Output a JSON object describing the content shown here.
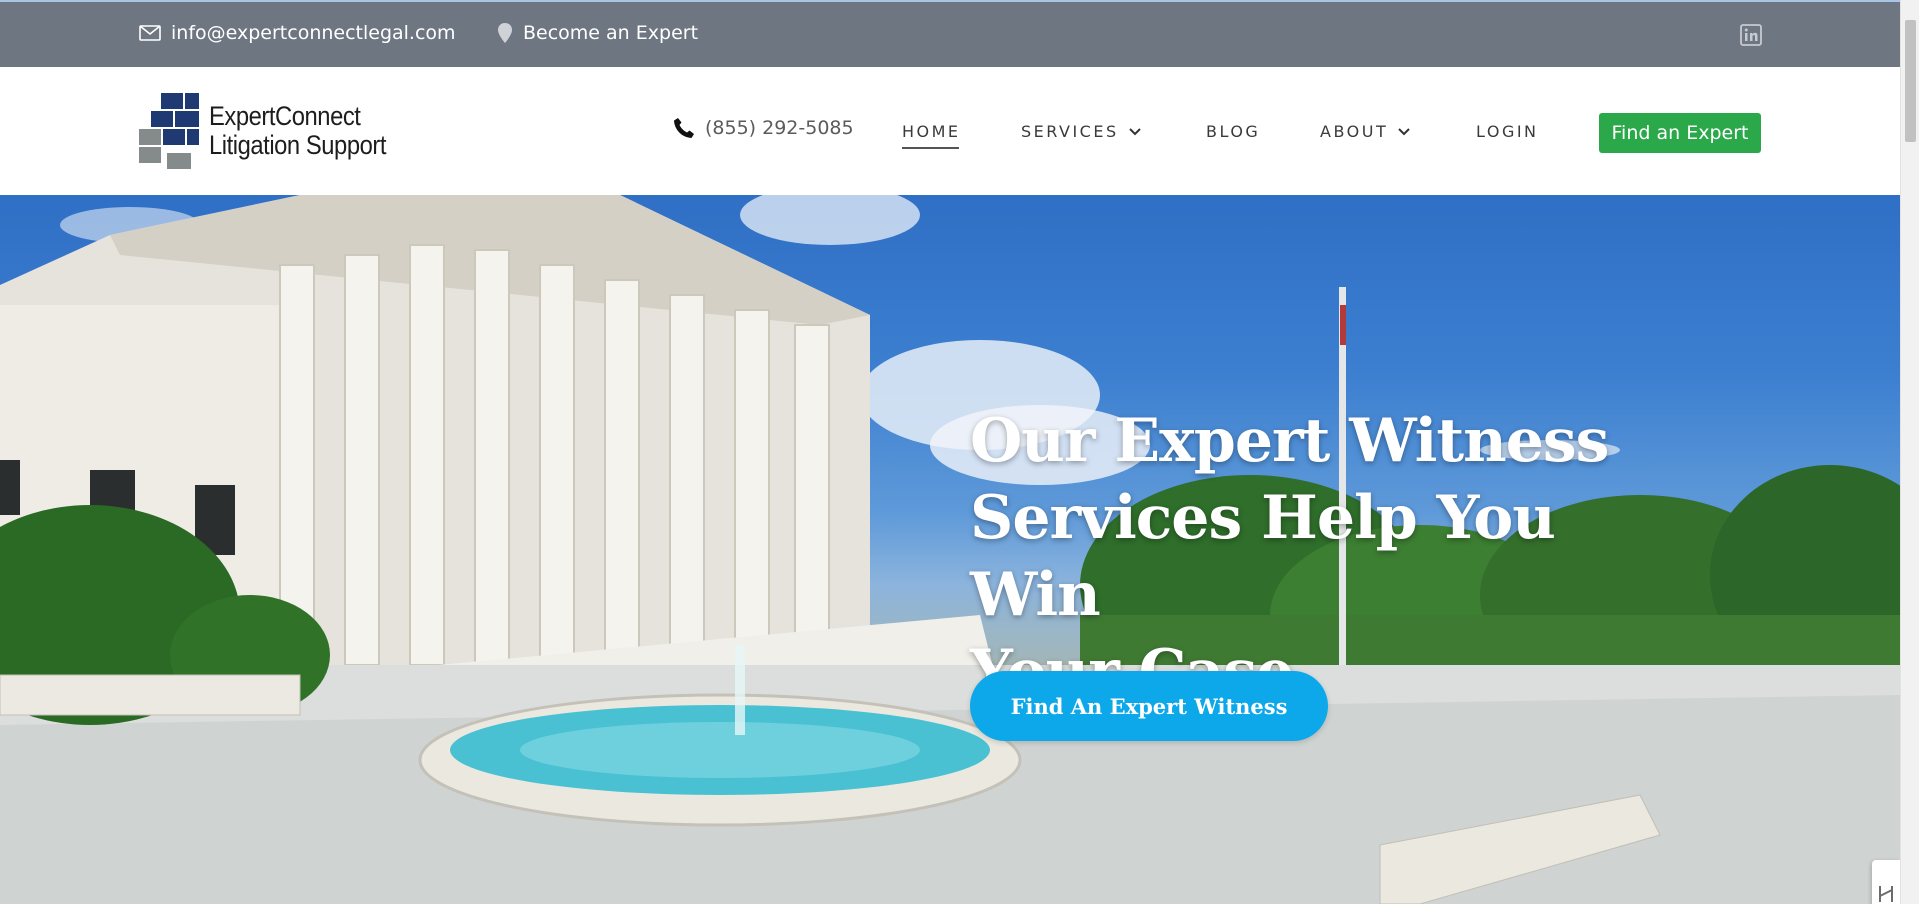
{
  "topbar": {
    "email": "info@expertconnectlegal.com",
    "become_expert": "Become an Expert"
  },
  "logo": {
    "line1": "ExpertConnect",
    "line2": "Litigation Support"
  },
  "header": {
    "phone": "(855) 292-5085",
    "nav": {
      "home": "HOME",
      "services": "SERVICES",
      "blog": "BLOG",
      "about": "ABOUT",
      "login": "LOGIN"
    },
    "cta": "Find an Expert"
  },
  "hero": {
    "headline_line1": "Our Expert Witness",
    "headline_line2": "Services Help You Win",
    "headline_line3": "Your Case",
    "cta": "Find An Expert Witness"
  },
  "colors": {
    "topbar": "#6e7681",
    "green_cta": "#2aa84a",
    "hero_cta": "#0ca8ea",
    "logo_navy": "#1f3a73",
    "logo_gray": "#858b8a"
  },
  "icons": {
    "email": "envelope-icon",
    "location": "map-pin-icon",
    "social": "linkedin-icon",
    "phone": "phone-icon",
    "dropdown": "chevron-down-icon"
  }
}
